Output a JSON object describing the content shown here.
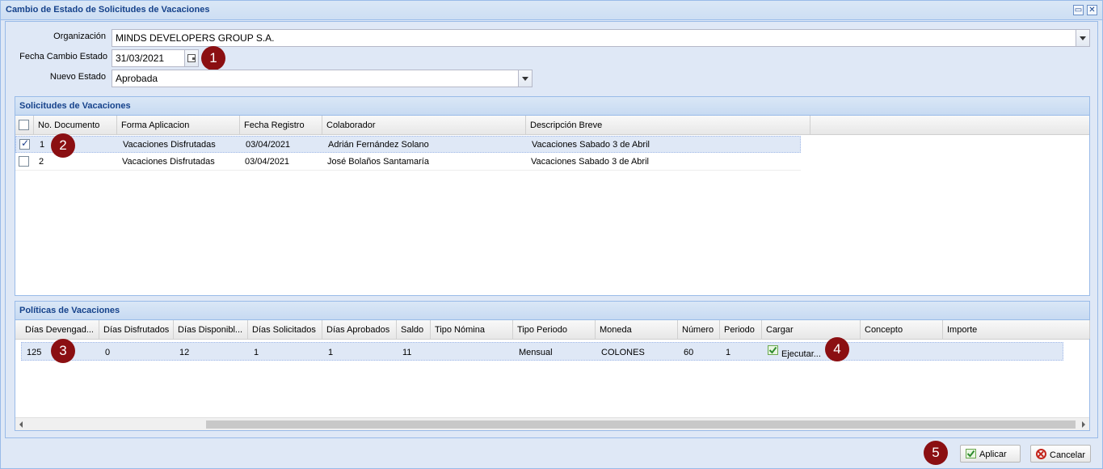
{
  "window": {
    "title": "Cambio de Estado de Solicitudes de Vacaciones"
  },
  "form": {
    "organizacion_label": "Organización",
    "organizacion_value": "MINDS DEVELOPERS GROUP S.A.",
    "fecha_label": "Fecha Cambio Estado",
    "fecha_value": "31/03/2021",
    "estado_label": "Nuevo Estado",
    "estado_value": "Aprobada"
  },
  "markers": [
    "1",
    "2",
    "3",
    "4",
    "5"
  ],
  "solicitudes": {
    "title": "Solicitudes de Vacaciones",
    "columns": [
      "No. Documento",
      "Forma Aplicacion",
      "Fecha Registro",
      "Colaborador",
      "Descripción Breve"
    ],
    "rows": [
      {
        "checked": true,
        "cells": [
          "1",
          "Vacaciones Disfrutadas",
          "03/04/2021",
          "Adrián Fernández Solano",
          "Vacaciones Sabado 3 de Abril"
        ]
      },
      {
        "checked": false,
        "cells": [
          "2",
          "Vacaciones Disfrutadas",
          "03/04/2021",
          "José Bolaños Santamaría",
          "Vacaciones Sabado 3 de Abril"
        ]
      }
    ]
  },
  "politicas": {
    "title": "Políticas de Vacaciones",
    "columns": [
      "Días Devengad...",
      "Días Disfrutados",
      "Días Disponibl...",
      "Días Solicitados",
      "Días Aprobados",
      "Saldo",
      "Tipo Nómina",
      "Tipo Periodo",
      "Moneda",
      "Número",
      "Periodo",
      "Cargar",
      "Concepto",
      "Importe"
    ],
    "row": [
      "125",
      "0",
      "12",
      "1",
      "1",
      "11",
      "",
      "Mensual",
      "COLONES",
      "60",
      "1",
      "Ejecutar...",
      "",
      ""
    ]
  },
  "buttons": {
    "aplicar": "Aplicar",
    "cancelar": "Cancelar"
  },
  "icons": {
    "restore": "restore-icon",
    "close": "close-icon",
    "ok": "check-icon",
    "cancel": "cancel-icon"
  },
  "colors": {
    "header_text": "#15428b",
    "marker": "#8b0f12",
    "panel_border": "#99bbe8"
  }
}
